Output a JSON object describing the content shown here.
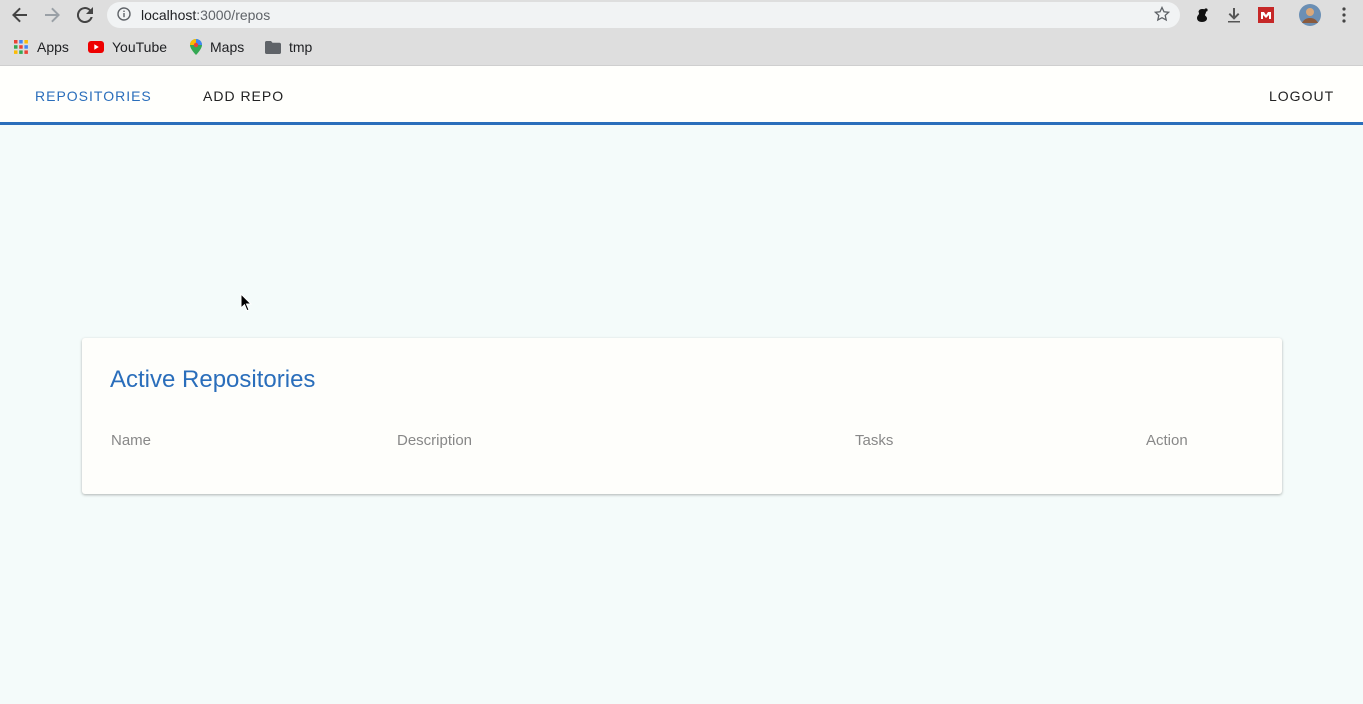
{
  "browser": {
    "url_host": "localhost",
    "url_path": ":3000/repos",
    "bookmarks": [
      {
        "label": "Apps",
        "icon": "apps-grid-icon"
      },
      {
        "label": "YouTube",
        "icon": "youtube-icon"
      },
      {
        "label": "Maps",
        "icon": "maps-pin-icon"
      },
      {
        "label": "tmp",
        "icon": "folder-icon"
      }
    ]
  },
  "nav": {
    "repositories_label": "REPOSITORIES",
    "add_repo_label": "ADD REPO",
    "logout_label": "LOGOUT"
  },
  "card": {
    "title": "Active Repositories",
    "columns": [
      "Name",
      "Description",
      "Tasks",
      "Action"
    ]
  },
  "colors": {
    "accent": "#2a6ebb",
    "page_bg": "#f4fbfa"
  }
}
